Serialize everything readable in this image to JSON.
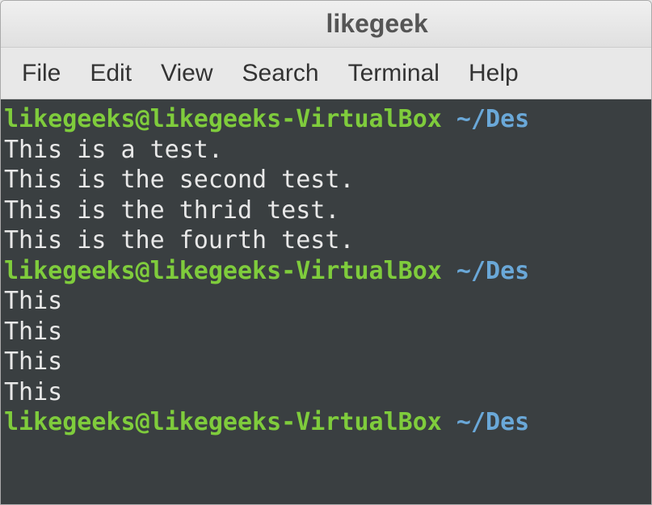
{
  "window": {
    "title": "likegeek"
  },
  "menubar": {
    "items": [
      "File",
      "Edit",
      "View",
      "Search",
      "Terminal",
      "Help"
    ]
  },
  "terminal": {
    "lines": [
      {
        "type": "prompt",
        "user_host": "likegeeks@likegeeks-VirtualBox",
        "path": " ~/Des"
      },
      {
        "type": "output",
        "text": "This is a test."
      },
      {
        "type": "output",
        "text": "This is the second test."
      },
      {
        "type": "output",
        "text": "This is the thrid test."
      },
      {
        "type": "output",
        "text": "This is the fourth test."
      },
      {
        "type": "prompt",
        "user_host": "likegeeks@likegeeks-VirtualBox",
        "path": " ~/Des"
      },
      {
        "type": "output",
        "text": "This"
      },
      {
        "type": "output",
        "text": "This"
      },
      {
        "type": "output",
        "text": "This"
      },
      {
        "type": "output",
        "text": "This"
      },
      {
        "type": "prompt",
        "user_host": "likegeeks@likegeeks-VirtualBox",
        "path": " ~/Des"
      }
    ]
  }
}
